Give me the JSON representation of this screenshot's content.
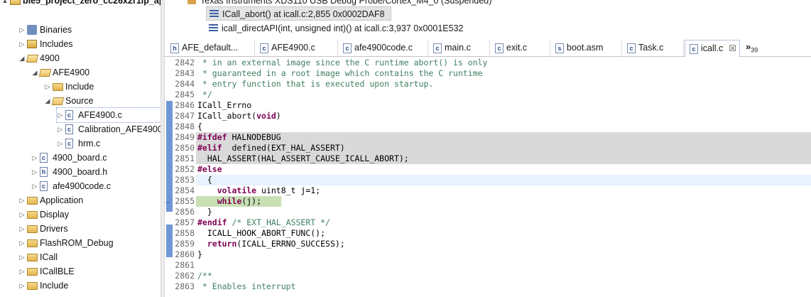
{
  "project_tree": {
    "items": [
      {
        "label": "ble5_project_zero_cc26x2r1lp_ap",
        "twisty": "▲",
        "icon": "project-icon"
      },
      {
        "label": "Binaries",
        "twisty": "▷",
        "icon": "binaries-icon"
      },
      {
        "label": "Includes",
        "twisty": "▷",
        "icon": "includes-icon"
      },
      {
        "label": "4900",
        "twisty": "◢",
        "icon": "folder-open-icon"
      },
      {
        "label": "AFE4900",
        "twisty": "◢",
        "icon": "folder-open-icon"
      },
      {
        "label": "Include",
        "twisty": "▷",
        "icon": "folder-icon"
      },
      {
        "label": "Source",
        "twisty": "◢",
        "icon": "folder-open-icon"
      },
      {
        "label": "AFE4900.c",
        "twisty": "▷",
        "icon": "c-file-icon"
      },
      {
        "label": "Calibration_AFE4900",
        "twisty": "▷",
        "icon": "c-file-icon"
      },
      {
        "label": "hrm.c",
        "twisty": "▷",
        "icon": "c-file-icon"
      },
      {
        "label": "4900_board.c",
        "twisty": "▷",
        "icon": "c-file-icon"
      },
      {
        "label": "4900_board.h",
        "twisty": "▷",
        "icon": "h-file-icon"
      },
      {
        "label": "afe4900code.c",
        "twisty": "▷",
        "icon": "c-file-icon"
      },
      {
        "label": "Application",
        "twisty": "▷",
        "icon": "folder-icon"
      },
      {
        "label": "Display",
        "twisty": "▷",
        "icon": "folder-icon"
      },
      {
        "label": "Drivers",
        "twisty": "▷",
        "icon": "folder-icon"
      },
      {
        "label": "FlashROM_Debug",
        "twisty": "▷",
        "icon": "folder-icon"
      },
      {
        "label": "ICall",
        "twisty": "▷",
        "icon": "folder-icon"
      },
      {
        "label": "ICallBLE",
        "twisty": "▷",
        "icon": "folder-icon"
      },
      {
        "label": "Include",
        "twisty": "▷",
        "icon": "folder-icon"
      }
    ]
  },
  "debug": {
    "top_row": "Texas Instruments XDS110 USB Debug Probe/Cortex_M4_0 (Suspended)",
    "frames": [
      {
        "label": "ICall_abort() at icall.c:2,855 0x0002DAF8",
        "selected": true
      },
      {
        "label": "icall_directAPI(int, unsigned int)() at icall.c:3,937 0x0001E532",
        "selected": false
      }
    ]
  },
  "tabs": [
    {
      "label": "AFE_default...",
      "icon": "h"
    },
    {
      "label": "AFE4900.c",
      "icon": "c"
    },
    {
      "label": "afe4900code.c",
      "icon": "c"
    },
    {
      "label": "main.c",
      "icon": "c"
    },
    {
      "label": "exit.c",
      "icon": "c"
    },
    {
      "label": "boot.asm",
      "icon": "s"
    },
    {
      "label": "Task.c",
      "icon": "c"
    },
    {
      "label": "icall.c",
      "icon": "c",
      "active": true,
      "close": "☒"
    }
  ],
  "tab_overflow": {
    "chevron": "»",
    "count": "39"
  },
  "code": [
    {
      "n": "2842",
      "t": " * in an external image since the C runtime abort() is only"
    },
    {
      "n": "2843",
      "t": " * guaranteed in a root image which contains the C runtime"
    },
    {
      "n": "2844",
      "t": " * entry function that is executed upon startup."
    },
    {
      "n": "2845",
      "t": " */"
    },
    {
      "n": "2846",
      "t": "ICall_Errno"
    },
    {
      "n": "2847",
      "t": "ICall_abort(void)"
    },
    {
      "n": "2848",
      "t": "{"
    },
    {
      "n": "2849",
      "t": "#ifdef HALNODEBUG"
    },
    {
      "n": "2850",
      "t": "#elif  defined(EXT_HAL_ASSERT)"
    },
    {
      "n": "2851",
      "t": "  HAL_ASSERT(HAL_ASSERT_CAUSE_ICALL_ABORT);"
    },
    {
      "n": "2852",
      "t": "#else"
    },
    {
      "n": "2853",
      "t": "  {"
    },
    {
      "n": "2854",
      "t": "    volatile uint8_t j=1;"
    },
    {
      "n": "2855",
      "t": "    while(j);"
    },
    {
      "n": "2856",
      "t": "  }"
    },
    {
      "n": "2857",
      "t": "#endif /* EXT_HAL_ASSERT */"
    },
    {
      "n": "2858",
      "t": "  ICALL_HOOK_ABORT_FUNC();"
    },
    {
      "n": "2859",
      "t": "  return(ICALL_ERRNO_SUCCESS);"
    },
    {
      "n": "2860",
      "t": "}"
    },
    {
      "n": "2861",
      "t": ""
    },
    {
      "n": "2862",
      "t": "/**"
    },
    {
      "n": "2863",
      "t": " * Enables interrupt"
    }
  ],
  "colors": {
    "comment": "#3f7f5f",
    "keyword": "#7f0055",
    "inactive_code_bg": "#d9d9d9",
    "current_line_bg": "#c8e0b4",
    "ruler_mark": "#6f97d6"
  }
}
